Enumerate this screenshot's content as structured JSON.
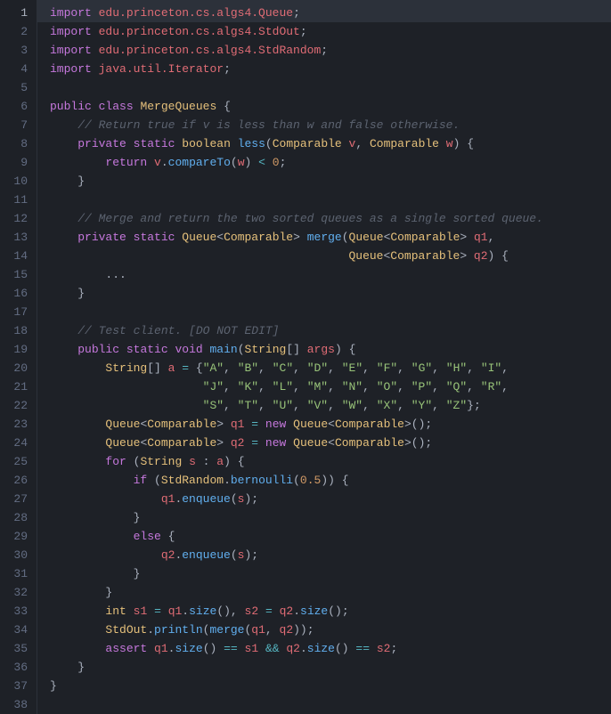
{
  "gutter": {
    "start": 1,
    "end": 38,
    "current": 1
  },
  "lines": [
    [
      [
        "kw",
        "import"
      ],
      [
        "plain",
        " "
      ],
      [
        "id",
        "edu.princeton.cs.algs4.Queue"
      ],
      [
        "plain",
        ";"
      ]
    ],
    [
      [
        "kw",
        "import"
      ],
      [
        "plain",
        " "
      ],
      [
        "id",
        "edu.princeton.cs.algs4.StdOut"
      ],
      [
        "plain",
        ";"
      ]
    ],
    [
      [
        "kw",
        "import"
      ],
      [
        "plain",
        " "
      ],
      [
        "id",
        "edu.princeton.cs.algs4.StdRandom"
      ],
      [
        "plain",
        ";"
      ]
    ],
    [
      [
        "kw",
        "import"
      ],
      [
        "plain",
        " "
      ],
      [
        "id",
        "java.util.Iterator"
      ],
      [
        "plain",
        ";"
      ]
    ],
    [],
    [
      [
        "kw",
        "public"
      ],
      [
        "plain",
        " "
      ],
      [
        "kw",
        "class"
      ],
      [
        "plain",
        " "
      ],
      [
        "type",
        "MergeQueues"
      ],
      [
        "plain",
        " {"
      ]
    ],
    [
      [
        "plain",
        "    "
      ],
      [
        "cmt",
        "// Return true if v is less than w and false otherwise."
      ]
    ],
    [
      [
        "plain",
        "    "
      ],
      [
        "kw",
        "private"
      ],
      [
        "plain",
        " "
      ],
      [
        "kw",
        "static"
      ],
      [
        "plain",
        " "
      ],
      [
        "type",
        "boolean"
      ],
      [
        "plain",
        " "
      ],
      [
        "fn",
        "less"
      ],
      [
        "plain",
        "("
      ],
      [
        "type",
        "Comparable"
      ],
      [
        "plain",
        " "
      ],
      [
        "id",
        "v"
      ],
      [
        "plain",
        ", "
      ],
      [
        "type",
        "Comparable"
      ],
      [
        "plain",
        " "
      ],
      [
        "id",
        "w"
      ],
      [
        "plain",
        ") {"
      ]
    ],
    [
      [
        "plain",
        "        "
      ],
      [
        "kw",
        "return"
      ],
      [
        "plain",
        " "
      ],
      [
        "id",
        "v"
      ],
      [
        "plain",
        "."
      ],
      [
        "fn",
        "compareTo"
      ],
      [
        "plain",
        "("
      ],
      [
        "id",
        "w"
      ],
      [
        "plain",
        ") "
      ],
      [
        "op",
        "<"
      ],
      [
        "plain",
        " "
      ],
      [
        "num",
        "0"
      ],
      [
        "plain",
        ";"
      ]
    ],
    [
      [
        "plain",
        "    }"
      ]
    ],
    [],
    [
      [
        "plain",
        "    "
      ],
      [
        "cmt",
        "// Merge and return the two sorted queues as a single sorted queue."
      ]
    ],
    [
      [
        "plain",
        "    "
      ],
      [
        "kw",
        "private"
      ],
      [
        "plain",
        " "
      ],
      [
        "kw",
        "static"
      ],
      [
        "plain",
        " "
      ],
      [
        "type",
        "Queue"
      ],
      [
        "plain",
        "<"
      ],
      [
        "type",
        "Comparable"
      ],
      [
        "plain",
        "> "
      ],
      [
        "fn",
        "merge"
      ],
      [
        "plain",
        "("
      ],
      [
        "type",
        "Queue"
      ],
      [
        "plain",
        "<"
      ],
      [
        "type",
        "Comparable"
      ],
      [
        "plain",
        "> "
      ],
      [
        "id",
        "q1"
      ],
      [
        "plain",
        ","
      ]
    ],
    [
      [
        "plain",
        "                                           "
      ],
      [
        "type",
        "Queue"
      ],
      [
        "plain",
        "<"
      ],
      [
        "type",
        "Comparable"
      ],
      [
        "plain",
        "> "
      ],
      [
        "id",
        "q2"
      ],
      [
        "plain",
        ") {"
      ]
    ],
    [
      [
        "plain",
        "        ..."
      ]
    ],
    [
      [
        "plain",
        "    }"
      ]
    ],
    [],
    [
      [
        "plain",
        "    "
      ],
      [
        "cmt",
        "// Test client. [DO NOT EDIT]"
      ]
    ],
    [
      [
        "plain",
        "    "
      ],
      [
        "kw",
        "public"
      ],
      [
        "plain",
        " "
      ],
      [
        "kw",
        "static"
      ],
      [
        "plain",
        " "
      ],
      [
        "kw",
        "void"
      ],
      [
        "plain",
        " "
      ],
      [
        "fn",
        "main"
      ],
      [
        "plain",
        "("
      ],
      [
        "type",
        "String"
      ],
      [
        "plain",
        "[] "
      ],
      [
        "id",
        "args"
      ],
      [
        "plain",
        ") {"
      ]
    ],
    [
      [
        "plain",
        "        "
      ],
      [
        "type",
        "String"
      ],
      [
        "plain",
        "[] "
      ],
      [
        "id",
        "a"
      ],
      [
        "plain",
        " "
      ],
      [
        "op",
        "="
      ],
      [
        "plain",
        " {"
      ],
      [
        "str",
        "\"A\""
      ],
      [
        "plain",
        ", "
      ],
      [
        "str",
        "\"B\""
      ],
      [
        "plain",
        ", "
      ],
      [
        "str",
        "\"C\""
      ],
      [
        "plain",
        ", "
      ],
      [
        "str",
        "\"D\""
      ],
      [
        "plain",
        ", "
      ],
      [
        "str",
        "\"E\""
      ],
      [
        "plain",
        ", "
      ],
      [
        "str",
        "\"F\""
      ],
      [
        "plain",
        ", "
      ],
      [
        "str",
        "\"G\""
      ],
      [
        "plain",
        ", "
      ],
      [
        "str",
        "\"H\""
      ],
      [
        "plain",
        ", "
      ],
      [
        "str",
        "\"I\""
      ],
      [
        "plain",
        ","
      ]
    ],
    [
      [
        "plain",
        "                      "
      ],
      [
        "str",
        "\"J\""
      ],
      [
        "plain",
        ", "
      ],
      [
        "str",
        "\"K\""
      ],
      [
        "plain",
        ", "
      ],
      [
        "str",
        "\"L\""
      ],
      [
        "plain",
        ", "
      ],
      [
        "str",
        "\"M\""
      ],
      [
        "plain",
        ", "
      ],
      [
        "str",
        "\"N\""
      ],
      [
        "plain",
        ", "
      ],
      [
        "str",
        "\"O\""
      ],
      [
        "plain",
        ", "
      ],
      [
        "str",
        "\"P\""
      ],
      [
        "plain",
        ", "
      ],
      [
        "str",
        "\"Q\""
      ],
      [
        "plain",
        ", "
      ],
      [
        "str",
        "\"R\""
      ],
      [
        "plain",
        ","
      ]
    ],
    [
      [
        "plain",
        "                      "
      ],
      [
        "str",
        "\"S\""
      ],
      [
        "plain",
        ", "
      ],
      [
        "str",
        "\"T\""
      ],
      [
        "plain",
        ", "
      ],
      [
        "str",
        "\"U\""
      ],
      [
        "plain",
        ", "
      ],
      [
        "str",
        "\"V\""
      ],
      [
        "plain",
        ", "
      ],
      [
        "str",
        "\"W\""
      ],
      [
        "plain",
        ", "
      ],
      [
        "str",
        "\"X\""
      ],
      [
        "plain",
        ", "
      ],
      [
        "str",
        "\"Y\""
      ],
      [
        "plain",
        ", "
      ],
      [
        "str",
        "\"Z\""
      ],
      [
        "plain",
        "};"
      ]
    ],
    [
      [
        "plain",
        "        "
      ],
      [
        "type",
        "Queue"
      ],
      [
        "plain",
        "<"
      ],
      [
        "type",
        "Comparable"
      ],
      [
        "plain",
        "> "
      ],
      [
        "id",
        "q1"
      ],
      [
        "plain",
        " "
      ],
      [
        "op",
        "="
      ],
      [
        "plain",
        " "
      ],
      [
        "kw",
        "new"
      ],
      [
        "plain",
        " "
      ],
      [
        "type",
        "Queue"
      ],
      [
        "plain",
        "<"
      ],
      [
        "type",
        "Comparable"
      ],
      [
        "plain",
        ">();"
      ]
    ],
    [
      [
        "plain",
        "        "
      ],
      [
        "type",
        "Queue"
      ],
      [
        "plain",
        "<"
      ],
      [
        "type",
        "Comparable"
      ],
      [
        "plain",
        "> "
      ],
      [
        "id",
        "q2"
      ],
      [
        "plain",
        " "
      ],
      [
        "op",
        "="
      ],
      [
        "plain",
        " "
      ],
      [
        "kw",
        "new"
      ],
      [
        "plain",
        " "
      ],
      [
        "type",
        "Queue"
      ],
      [
        "plain",
        "<"
      ],
      [
        "type",
        "Comparable"
      ],
      [
        "plain",
        ">();"
      ]
    ],
    [
      [
        "plain",
        "        "
      ],
      [
        "kw",
        "for"
      ],
      [
        "plain",
        " ("
      ],
      [
        "type",
        "String"
      ],
      [
        "plain",
        " "
      ],
      [
        "id",
        "s"
      ],
      [
        "plain",
        " : "
      ],
      [
        "id",
        "a"
      ],
      [
        "plain",
        ") {"
      ]
    ],
    [
      [
        "plain",
        "            "
      ],
      [
        "kw",
        "if"
      ],
      [
        "plain",
        " ("
      ],
      [
        "type",
        "StdRandom"
      ],
      [
        "plain",
        "."
      ],
      [
        "fn",
        "bernoulli"
      ],
      [
        "plain",
        "("
      ],
      [
        "num",
        "0.5"
      ],
      [
        "plain",
        ")) {"
      ]
    ],
    [
      [
        "plain",
        "                "
      ],
      [
        "id",
        "q1"
      ],
      [
        "plain",
        "."
      ],
      [
        "fn",
        "enqueue"
      ],
      [
        "plain",
        "("
      ],
      [
        "id",
        "s"
      ],
      [
        "plain",
        ");"
      ]
    ],
    [
      [
        "plain",
        "            }"
      ]
    ],
    [
      [
        "plain",
        "            "
      ],
      [
        "kw",
        "else"
      ],
      [
        "plain",
        " {"
      ]
    ],
    [
      [
        "plain",
        "                "
      ],
      [
        "id",
        "q2"
      ],
      [
        "plain",
        "."
      ],
      [
        "fn",
        "enqueue"
      ],
      [
        "plain",
        "("
      ],
      [
        "id",
        "s"
      ],
      [
        "plain",
        ");"
      ]
    ],
    [
      [
        "plain",
        "            }"
      ]
    ],
    [
      [
        "plain",
        "        }"
      ]
    ],
    [
      [
        "plain",
        "        "
      ],
      [
        "type",
        "int"
      ],
      [
        "plain",
        " "
      ],
      [
        "id",
        "s1"
      ],
      [
        "plain",
        " "
      ],
      [
        "op",
        "="
      ],
      [
        "plain",
        " "
      ],
      [
        "id",
        "q1"
      ],
      [
        "plain",
        "."
      ],
      [
        "fn",
        "size"
      ],
      [
        "plain",
        "(), "
      ],
      [
        "id",
        "s2"
      ],
      [
        "plain",
        " "
      ],
      [
        "op",
        "="
      ],
      [
        "plain",
        " "
      ],
      [
        "id",
        "q2"
      ],
      [
        "plain",
        "."
      ],
      [
        "fn",
        "size"
      ],
      [
        "plain",
        "();"
      ]
    ],
    [
      [
        "plain",
        "        "
      ],
      [
        "type",
        "StdOut"
      ],
      [
        "plain",
        "."
      ],
      [
        "fn",
        "println"
      ],
      [
        "plain",
        "("
      ],
      [
        "fn",
        "merge"
      ],
      [
        "plain",
        "("
      ],
      [
        "id",
        "q1"
      ],
      [
        "plain",
        ", "
      ],
      [
        "id",
        "q2"
      ],
      [
        "plain",
        "));"
      ]
    ],
    [
      [
        "plain",
        "        "
      ],
      [
        "kw",
        "assert"
      ],
      [
        "plain",
        " "
      ],
      [
        "id",
        "q1"
      ],
      [
        "plain",
        "."
      ],
      [
        "fn",
        "size"
      ],
      [
        "plain",
        "() "
      ],
      [
        "op",
        "=="
      ],
      [
        "plain",
        " "
      ],
      [
        "id",
        "s1"
      ],
      [
        "plain",
        " "
      ],
      [
        "op",
        "&&"
      ],
      [
        "plain",
        " "
      ],
      [
        "id",
        "q2"
      ],
      [
        "plain",
        "."
      ],
      [
        "fn",
        "size"
      ],
      [
        "plain",
        "() "
      ],
      [
        "op",
        "=="
      ],
      [
        "plain",
        " "
      ],
      [
        "id",
        "s2"
      ],
      [
        "plain",
        ";"
      ]
    ],
    [
      [
        "plain",
        "    }"
      ]
    ],
    [
      [
        "plain",
        "}"
      ]
    ],
    []
  ]
}
